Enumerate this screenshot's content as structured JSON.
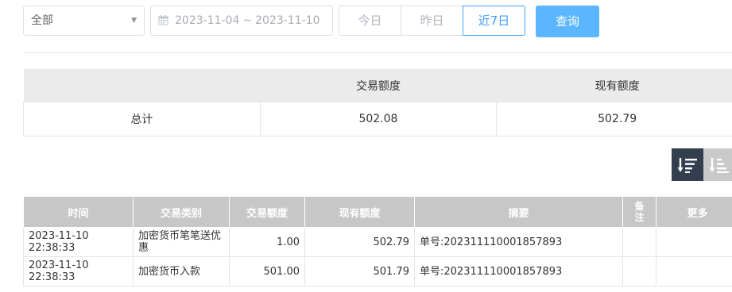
{
  "filter": {
    "type_select": "全部",
    "date_start": "2023-11-04",
    "date_sep": "~",
    "date_end": "2023-11-10",
    "quick_ranges": [
      "今日",
      "昨日",
      "近7日"
    ],
    "active_range": "近7日",
    "query_label": "查询"
  },
  "summary": {
    "headers": [
      "",
      "交易额度",
      "现有额度"
    ],
    "row_label": "总计",
    "trade_amount": "502.08",
    "current_amount": "502.79"
  },
  "detail": {
    "headers": [
      "时间",
      "交易类别",
      "交易额度",
      "现有额度",
      "摘要",
      "备注",
      "更多"
    ],
    "rows": [
      {
        "time": "2023-11-10 22:38:33",
        "category": "加密货币笔笔送优惠",
        "amount": "1.00",
        "balance": "502.79",
        "summary": "单号:202311110001857893",
        "note": "",
        "more": ""
      },
      {
        "time": "2023-11-10 22:38:33",
        "category": "加密货币入款",
        "amount": "501.00",
        "balance": "501.79",
        "summary": "单号:202311110001857893",
        "note": "",
        "more": ""
      }
    ]
  },
  "colors": {
    "accent": "#409eff",
    "query_button": "#5cb6ff",
    "sort_active": "#333e4e",
    "sort_inactive": "#c9c9c9",
    "table_header": "#c7c7c7"
  },
  "icons": [
    "chevron-down-icon",
    "calendar-icon",
    "sort-descending-icon",
    "sort-ascending-icon"
  ]
}
